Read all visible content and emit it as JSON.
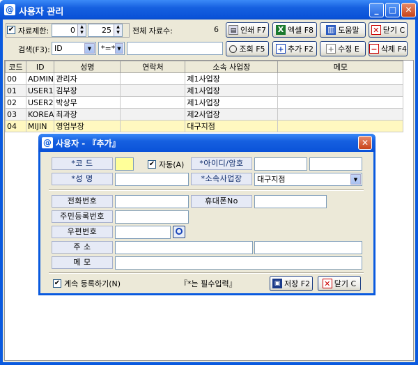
{
  "window": {
    "title": "사용자 관리",
    "icon": "@"
  },
  "toolbar": {
    "limit_label": "자료제한:",
    "limit_checked": true,
    "limit_from": "0",
    "limit_to": "25",
    "total_label": "전체 자료수:",
    "total_value": "6",
    "print": "인쇄 F7",
    "excel": "엑셀 F8",
    "help": "도움말",
    "close": "닫기 C"
  },
  "search": {
    "label": "검색(F3):",
    "field_select": "ID",
    "op_select": "*=*",
    "query": "",
    "find": "조회 F5",
    "add": "추가 F2",
    "edit": "수정 E",
    "delete": "삭제 F4"
  },
  "grid": {
    "columns": [
      "코드",
      "ID",
      "성명",
      "연락처",
      "소속 사업장",
      "메모"
    ],
    "rows": [
      [
        "00",
        "ADMIN",
        "관리자",
        "",
        "제1사업장",
        ""
      ],
      [
        "01",
        "USER1",
        "김부장",
        "",
        "제1사업장",
        ""
      ],
      [
        "02",
        "USER2",
        "박상무",
        "",
        "제1사업장",
        ""
      ],
      [
        "03",
        "KOREA",
        "최과장",
        "",
        "제2사업장",
        ""
      ],
      [
        "04",
        "MIJIN",
        "영업부장",
        "",
        "대구지점",
        ""
      ]
    ],
    "selected_row": 4
  },
  "dialog": {
    "title": "사용자 - 『추가』",
    "code_label": "*코 드",
    "auto_label": "자동(A)",
    "auto_checked": true,
    "idpw_label": "*아이디/암호",
    "name_label": "*성 명",
    "site_label": "*소속사업장",
    "site_value": "대구지점",
    "phone_label": "전화번호",
    "mobile_label": "휴대폰No",
    "resident_label": "주민등록번호",
    "zip_label": "우편번호",
    "address_label": "주 소",
    "memo_label": "메 모",
    "continue_label": "계속 등록하기(N)",
    "continue_checked": true,
    "required_note": "『*는 필수입력』",
    "save": "저장 F2",
    "close": "닫기 C"
  },
  "colors": {
    "title_blue": "#0a5adf",
    "face": "#ece9d8",
    "selected_row": "#fff8c0",
    "code_highlight": "#ffff99"
  }
}
